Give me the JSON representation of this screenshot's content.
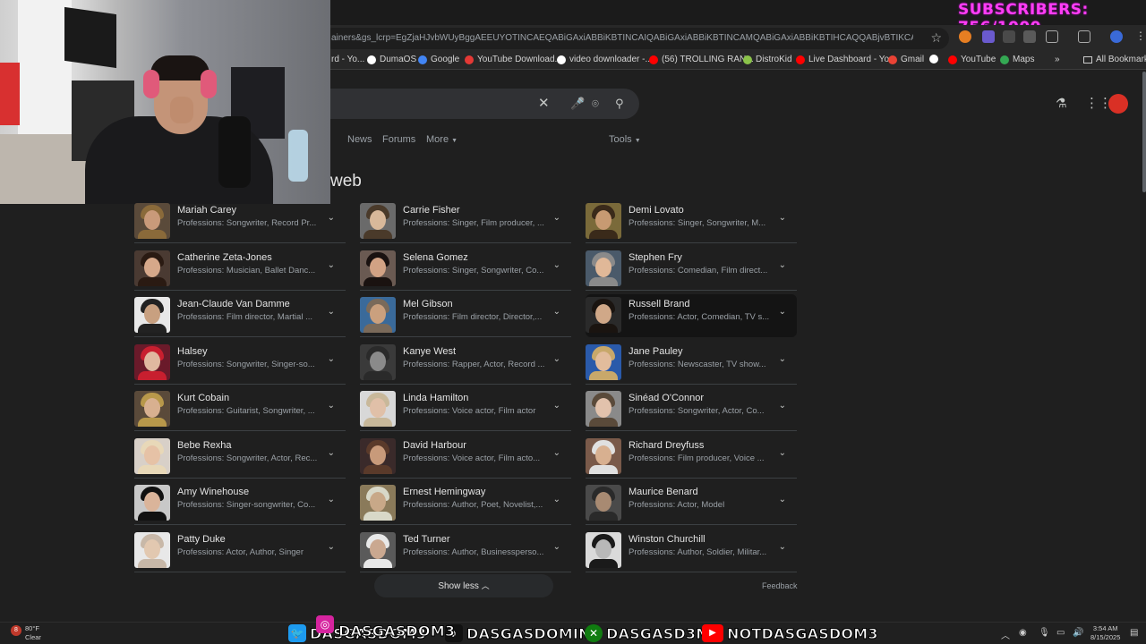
{
  "overlay": {
    "subscribers": "SUBSCRIBERS: 756/1000"
  },
  "browser": {
    "url": "ainers&gs_lcrp=EgZjaHJvbWUyBggAEEUYOTINCAEQABiGAxiABBiKBTINCAIQABiGAxiABBiKBTINCAMQABiGAxiABBiKBTIHCAQQABjvBTIKCAUQABiABBiiBDIKCAY...",
    "bookmarks": [
      {
        "label": "rd - Yo...",
        "color": "#ff0000"
      },
      {
        "label": "DumaOS",
        "color": "#ffffff"
      },
      {
        "label": "Google",
        "color": "#4285f4"
      },
      {
        "label": "YouTube Download...",
        "color": "#e53935"
      },
      {
        "label": "video downloader -...",
        "color": "#ffffff"
      },
      {
        "label": "(56) TROLLING RAN...",
        "color": "#ff0000"
      },
      {
        "label": "DistroKid",
        "color": "#8bc34a"
      },
      {
        "label": "Live Dashboard - Yo...",
        "color": "#ff0000"
      },
      {
        "label": "Gmail",
        "color": "#ea4335"
      },
      {
        "label": "YouTube",
        "color": "#ff0000"
      },
      {
        "label": "Maps",
        "color": "#34a853"
      }
    ],
    "more_bookmarks": "»",
    "all_bookmarks": "All Bookmarks"
  },
  "search": {
    "tabs": [
      "News",
      "Forums",
      "More"
    ],
    "tools_label": "Tools",
    "heading_fragment": "web"
  },
  "people": [
    {
      "name": "Mariah Carey",
      "profession": "Professions: Songwriter, Record Pr...",
      "skin": "#c99a7a",
      "hair": "#8a6a3a",
      "bg": "#5a4a3a"
    },
    {
      "name": "Carrie Fisher",
      "profession": "Professions: Singer, Film producer, ...",
      "skin": "#d8b89a",
      "hair": "#4a3a2a",
      "bg": "#6a6a6a"
    },
    {
      "name": "Demi Lovato",
      "profession": "Professions: Singer, Songwriter, M...",
      "skin": "#c79a72",
      "hair": "#3a2a1a",
      "bg": "#7a6a3a"
    },
    {
      "name": "Catherine Zeta-Jones",
      "profession": "Professions: Musician, Ballet Danc...",
      "skin": "#d6a88a",
      "hair": "#2a1a12",
      "bg": "#4a3a32"
    },
    {
      "name": "Selena Gomez",
      "profession": "Professions: Singer, Songwriter, Co...",
      "skin": "#d2a284",
      "hair": "#1a1210",
      "bg": "#6a5a52"
    },
    {
      "name": "Stephen Fry",
      "profession": "Professions: Comedian, Film direct...",
      "skin": "#e0b898",
      "hair": "#8a8a8a",
      "bg": "#4a5a6a"
    },
    {
      "name": "Jean-Claude Van Damme",
      "profession": "Professions: Film director, Martial ...",
      "skin": "#c8a080",
      "hair": "#222222",
      "bg": "#e8e8e8"
    },
    {
      "name": "Mel Gibson",
      "profession": "Professions: Film director, Director,...",
      "skin": "#caa07e",
      "hair": "#7a6a5a",
      "bg": "#3a6a9a"
    },
    {
      "name": "Russell Brand",
      "profession": "Professions: Actor, Comedian, TV s...",
      "skin": "#d0a888",
      "hair": "#1a1410",
      "bg": "#2a2a2a"
    },
    {
      "name": "Halsey",
      "profession": "Professions: Songwriter, Singer-so...",
      "skin": "#e0b8a0",
      "hair": "#c81f2f",
      "bg": "#6a1a2a"
    },
    {
      "name": "Kanye West",
      "profession": "Professions: Rapper, Actor, Record ...",
      "skin": "#8a8a8a",
      "hair": "#2a2a2a",
      "bg": "#3a3a3a"
    },
    {
      "name": "Jane Pauley",
      "profession": "Professions: Newscaster, TV show...",
      "skin": "#e2bc9c",
      "hair": "#c8a86a",
      "bg": "#2a5aaa"
    },
    {
      "name": "Kurt Cobain",
      "profession": "Professions: Guitarist, Songwriter, ...",
      "skin": "#d8b090",
      "hair": "#b8984a",
      "bg": "#5a4a3a"
    },
    {
      "name": "Linda Hamilton",
      "profession": "Professions: Voice actor, Film actor",
      "skin": "#e0c0a8",
      "hair": "#c8b89a",
      "bg": "#d8d8d8"
    },
    {
      "name": "Sinéad O'Connor",
      "profession": "Professions: Songwriter, Actor, Co...",
      "skin": "#e2c2ac",
      "hair": "#5a4a3a",
      "bg": "#8a8a8a"
    },
    {
      "name": "Bebe Rexha",
      "profession": "Professions: Songwriter, Actor, Rec...",
      "skin": "#e6c2a6",
      "hair": "#e8d8b8",
      "bg": "#d8d0c8"
    },
    {
      "name": "David Harbour",
      "profession": "Professions: Voice actor, Film acto...",
      "skin": "#c89a7a",
      "hair": "#5a3a2a",
      "bg": "#3a2a2a"
    },
    {
      "name": "Richard Dreyfuss",
      "profession": "Professions: Film producer, Voice ...",
      "skin": "#d8b090",
      "hair": "#e0e0e0",
      "bg": "#7a5a4a"
    },
    {
      "name": "Amy Winehouse",
      "profession": "Professions: Singer-songwriter, Co...",
      "skin": "#dab49a",
      "hair": "#111111",
      "bg": "#c8c8c8"
    },
    {
      "name": "Ernest Hemingway",
      "profession": "Professions: Author, Poet, Novelist,...",
      "skin": "#c8a888",
      "hair": "#d8d8c8",
      "bg": "#8a7a5a"
    },
    {
      "name": "Maurice Benard",
      "profession": "Professions: Actor, Model",
      "skin": "#a88a72",
      "hair": "#2a2a2a",
      "bg": "#4a4a4a"
    },
    {
      "name": "Patty Duke",
      "profession": "Professions: Actor, Author, Singer",
      "skin": "#e2c8b0",
      "hair": "#c8b8a8",
      "bg": "#e8e8e8"
    },
    {
      "name": "Ted Turner",
      "profession": "Professions: Author, Businessperso...",
      "skin": "#caa890",
      "hair": "#e8e8e8",
      "bg": "#5a5a5a"
    },
    {
      "name": "Winston Churchill",
      "profession": "Professions: Author, Soldier, Militar...",
      "skin": "#b8b8b8",
      "hair": "#1a1a1a",
      "bg": "#dadada"
    }
  ],
  "footer": {
    "show_less": "Show less",
    "feedback": "Feedback"
  },
  "taskbar": {
    "weather_temp": "80°F",
    "weather_desc": "Clear",
    "weather_badge": "8",
    "socials": [
      {
        "platform": "twitter",
        "handle": "DASGASDOM3",
        "color": "#1d9bf0",
        "glyph": "🐦"
      },
      {
        "platform": "instagram",
        "handle": "DASGASDOM3",
        "color": "#d6249f",
        "glyph": "◎"
      },
      {
        "platform": "tiktok",
        "handle": "DASGASDOMINI",
        "color": "#111111",
        "glyph": "♪"
      },
      {
        "platform": "xbox",
        "handle": "DASGASD3M",
        "color": "#107c10",
        "glyph": "✕"
      },
      {
        "platform": "youtube",
        "handle": "NOTDASGASDOM3",
        "color": "#ff0000",
        "glyph": "▶"
      }
    ],
    "time": "3:54 AM",
    "date": "8/15/2025"
  }
}
